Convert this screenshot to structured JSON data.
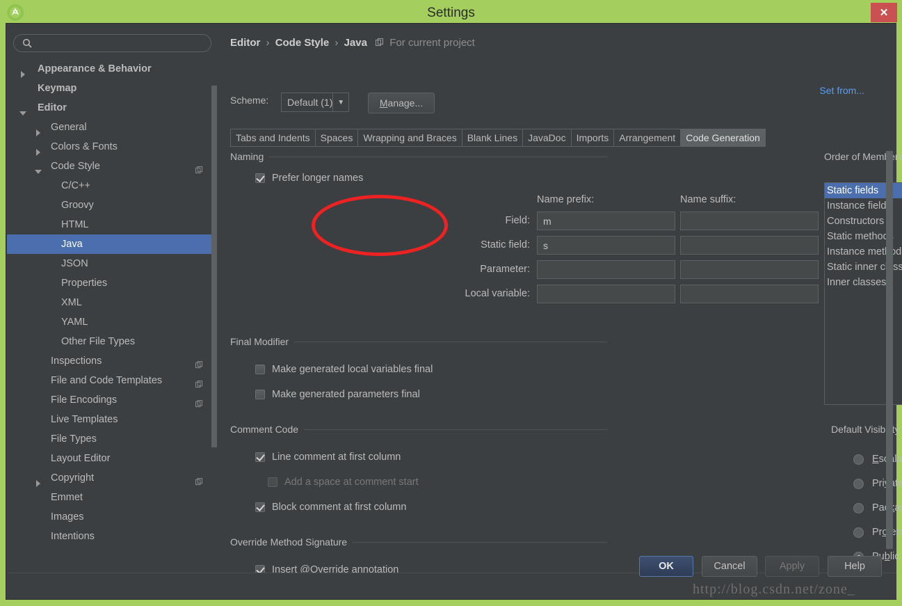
{
  "window": {
    "title": "Settings",
    "app_icon": "android-studio-icon",
    "close_label": "✕",
    "titlebar_color": "#a4cf5f",
    "accent_color": "#4b6eaf",
    "annotation_color": "#ee2222"
  },
  "sidebar": {
    "search_placeholder": "",
    "search_value": "",
    "items": [
      {
        "label": "Appearance & Behavior",
        "level": 0,
        "arrow": "collapsed",
        "bold": true,
        "selected": false,
        "copy_icon": false
      },
      {
        "label": "Keymap",
        "level": 0,
        "arrow": "none",
        "bold": true,
        "selected": false,
        "copy_icon": false
      },
      {
        "label": "Editor",
        "level": 0,
        "arrow": "expanded",
        "bold": true,
        "selected": false,
        "copy_icon": false
      },
      {
        "label": "General",
        "level": 1,
        "arrow": "collapsed",
        "bold": false,
        "selected": false,
        "copy_icon": false
      },
      {
        "label": "Colors & Fonts",
        "level": 1,
        "arrow": "collapsed",
        "bold": false,
        "selected": false,
        "copy_icon": false
      },
      {
        "label": "Code Style",
        "level": 1,
        "arrow": "expanded",
        "bold": false,
        "selected": false,
        "copy_icon": true
      },
      {
        "label": "C/C++",
        "level": 2,
        "arrow": "none",
        "bold": false,
        "selected": false,
        "copy_icon": false
      },
      {
        "label": "Groovy",
        "level": 2,
        "arrow": "none",
        "bold": false,
        "selected": false,
        "copy_icon": false
      },
      {
        "label": "HTML",
        "level": 2,
        "arrow": "none",
        "bold": false,
        "selected": false,
        "copy_icon": false
      },
      {
        "label": "Java",
        "level": 2,
        "arrow": "none",
        "bold": false,
        "selected": true,
        "copy_icon": false
      },
      {
        "label": "JSON",
        "level": 2,
        "arrow": "none",
        "bold": false,
        "selected": false,
        "copy_icon": false
      },
      {
        "label": "Properties",
        "level": 2,
        "arrow": "none",
        "bold": false,
        "selected": false,
        "copy_icon": false
      },
      {
        "label": "XML",
        "level": 2,
        "arrow": "none",
        "bold": false,
        "selected": false,
        "copy_icon": false
      },
      {
        "label": "YAML",
        "level": 2,
        "arrow": "none",
        "bold": false,
        "selected": false,
        "copy_icon": false
      },
      {
        "label": "Other File Types",
        "level": 2,
        "arrow": "none",
        "bold": false,
        "selected": false,
        "copy_icon": false
      },
      {
        "label": "Inspections",
        "level": 1,
        "arrow": "none",
        "bold": false,
        "selected": false,
        "copy_icon": true
      },
      {
        "label": "File and Code Templates",
        "level": 1,
        "arrow": "none",
        "bold": false,
        "selected": false,
        "copy_icon": true
      },
      {
        "label": "File Encodings",
        "level": 1,
        "arrow": "none",
        "bold": false,
        "selected": false,
        "copy_icon": true
      },
      {
        "label": "Live Templates",
        "level": 1,
        "arrow": "none",
        "bold": false,
        "selected": false,
        "copy_icon": false
      },
      {
        "label": "File Types",
        "level": 1,
        "arrow": "none",
        "bold": false,
        "selected": false,
        "copy_icon": false
      },
      {
        "label": "Layout Editor",
        "level": 1,
        "arrow": "none",
        "bold": false,
        "selected": false,
        "copy_icon": false
      },
      {
        "label": "Copyright",
        "level": 1,
        "arrow": "collapsed",
        "bold": false,
        "selected": false,
        "copy_icon": true
      },
      {
        "label": "Emmet",
        "level": 1,
        "arrow": "none",
        "bold": false,
        "selected": false,
        "copy_icon": false
      },
      {
        "label": "Images",
        "level": 1,
        "arrow": "none",
        "bold": false,
        "selected": false,
        "copy_icon": false
      },
      {
        "label": "Intentions",
        "level": 1,
        "arrow": "none",
        "bold": false,
        "selected": false,
        "copy_icon": false
      }
    ]
  },
  "header": {
    "crumb1": "Editor",
    "crumb2": "Code Style",
    "crumb3": "Java",
    "separator": "›",
    "project_note": "For current project",
    "scheme_label": "Scheme:",
    "scheme_value": "Default (1)",
    "scheme_arrow": "▼",
    "manage_mnemonic": "M",
    "manage_rest": "anage...",
    "set_from_label": "Set from..."
  },
  "tabs": [
    {
      "label": "Tabs and Indents",
      "active": false
    },
    {
      "label": "Spaces",
      "active": false
    },
    {
      "label": "Wrapping and Braces",
      "active": false
    },
    {
      "label": "Blank Lines",
      "active": false
    },
    {
      "label": "JavaDoc",
      "active": false
    },
    {
      "label": "Imports",
      "active": false
    },
    {
      "label": "Arrangement",
      "active": false
    },
    {
      "label": "Code Generation",
      "active": true
    }
  ],
  "naming": {
    "group_title": "Naming",
    "prefer_longer_names": {
      "label": "Prefer longer names",
      "checked": true
    },
    "col_prefix": "Name prefix:",
    "col_suffix": "Name suffix:",
    "rows": [
      {
        "label": "Field:",
        "prefix": "m",
        "suffix": ""
      },
      {
        "label": "Static field:",
        "prefix": "s",
        "suffix": ""
      },
      {
        "label": "Parameter:",
        "prefix": "",
        "suffix": ""
      },
      {
        "label": "Local variable:",
        "prefix": "",
        "suffix": ""
      }
    ]
  },
  "final_modifier": {
    "group_title": "Final Modifier",
    "options": [
      {
        "label": "Make generated local variables final",
        "checked": false,
        "disabled": false
      },
      {
        "label": "Make generated parameters final",
        "checked": false,
        "disabled": false
      }
    ]
  },
  "comment_code": {
    "group_title": "Comment Code",
    "options": [
      {
        "label": "Line comment at first column",
        "checked": true,
        "disabled": false,
        "indent": 0
      },
      {
        "label": "Add a space at comment start",
        "checked": false,
        "disabled": true,
        "indent": 1
      },
      {
        "label": "Block comment at first column",
        "checked": true,
        "disabled": false,
        "indent": 0
      }
    ]
  },
  "override_method_signature": {
    "group_title": "Override Method Signature",
    "options": [
      {
        "label": "Insert @Override annotation",
        "checked": true,
        "disabled": false
      }
    ]
  },
  "order_of_members": {
    "group_title": "Order of Members",
    "items": [
      {
        "label": "Static fields",
        "selected": true
      },
      {
        "label": "Instance fields",
        "selected": false
      },
      {
        "label": "Constructors",
        "selected": false
      },
      {
        "label": "Static methods",
        "selected": false
      },
      {
        "label": "Instance methods",
        "selected": false
      },
      {
        "label": "Static inner classes",
        "selected": false
      },
      {
        "label": "Inner classes",
        "selected": false
      }
    ],
    "move_up_icon": "arrow-up-icon",
    "move_down_icon": "arrow-down-icon",
    "move_up_enabled": false,
    "move_down_enabled": true
  },
  "default_visibility": {
    "group_title": "Default Visibility",
    "options": [
      {
        "pre": "",
        "mnemonic": "E",
        "post": "scalate",
        "selected": false
      },
      {
        "pre": "Pri",
        "mnemonic": "v",
        "post": "ate",
        "selected": false
      },
      {
        "pre": "Pac",
        "mnemonic": "k",
        "post": "age local",
        "selected": false
      },
      {
        "pre": "Pr",
        "mnemonic": "o",
        "post": "tected",
        "selected": false
      },
      {
        "pre": "Pu",
        "mnemonic": "b",
        "post": "lic",
        "selected": true
      }
    ]
  },
  "footer": {
    "ok_label": "OK",
    "cancel_label": "Cancel",
    "apply_label": "Apply",
    "help_label": "Help"
  },
  "watermark": "http://blog.csdn.net/zone_"
}
